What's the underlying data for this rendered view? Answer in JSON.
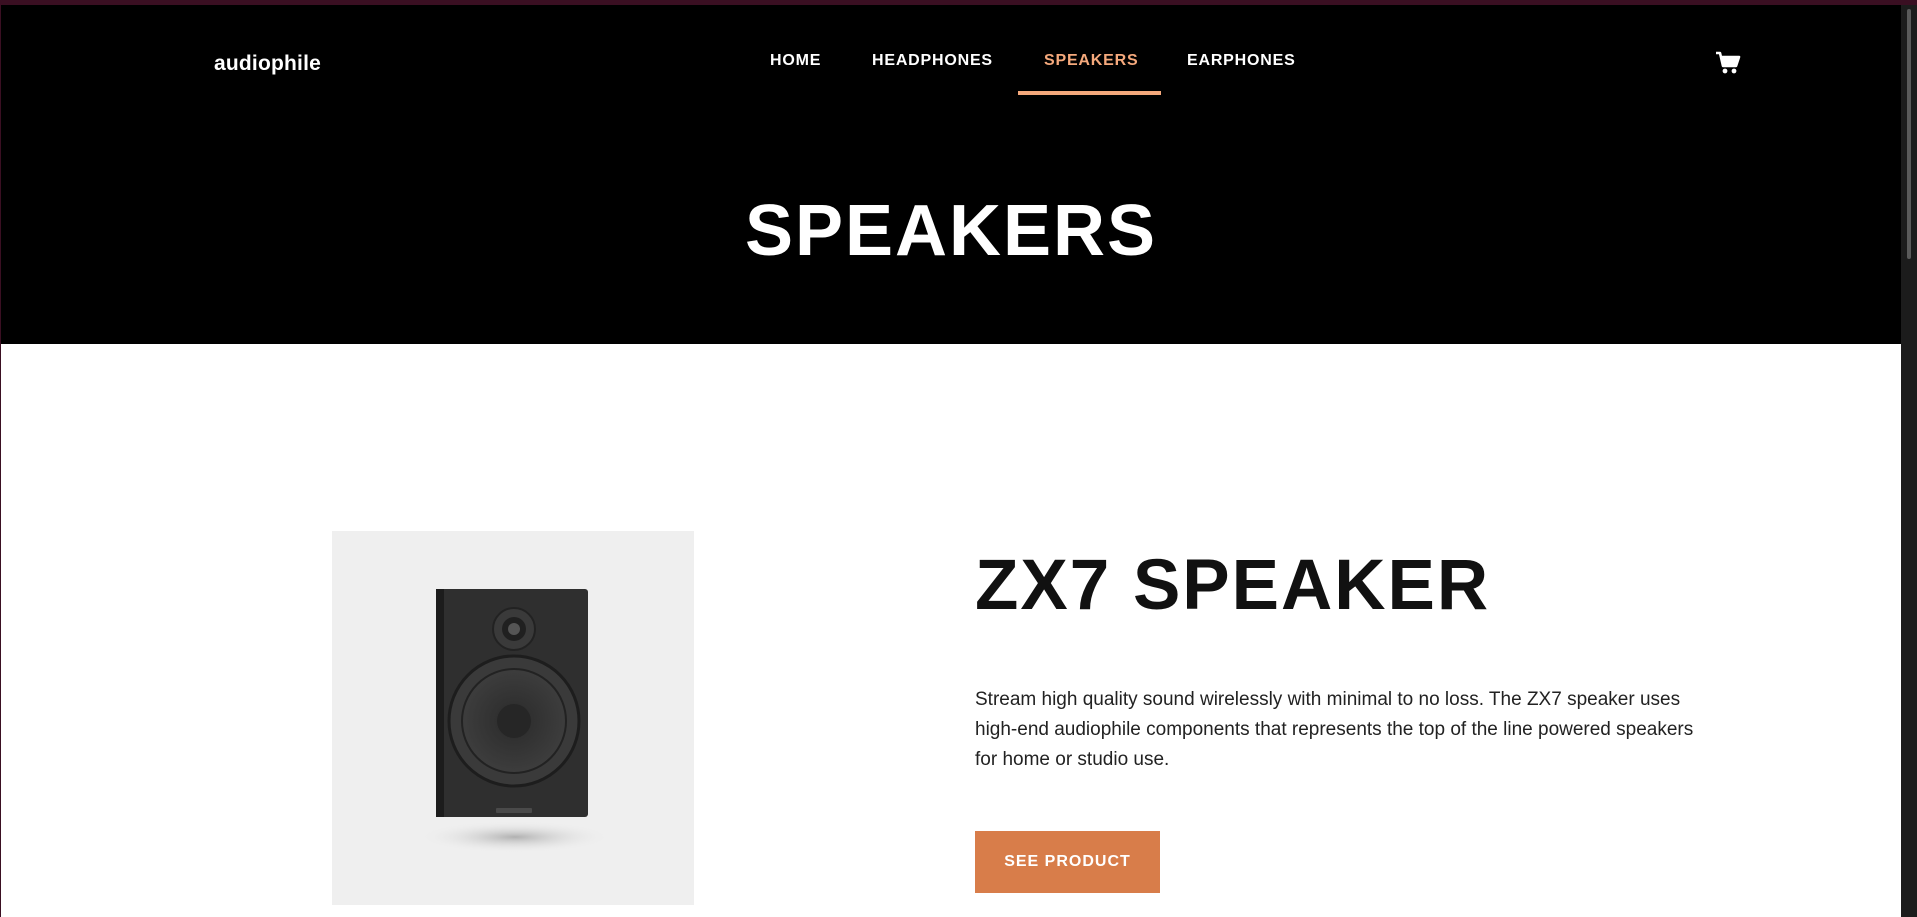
{
  "header": {
    "logo": "audiophile",
    "nav": [
      {
        "label": "HOME",
        "active": false
      },
      {
        "label": "HEADPHONES",
        "active": false
      },
      {
        "label": "SPEAKERS",
        "active": true
      },
      {
        "label": "EARPHONES",
        "active": false
      }
    ],
    "cart_icon": "shopping-cart-icon"
  },
  "hero": {
    "title": "SPEAKERS"
  },
  "product": {
    "title": "ZX7 SPEAKER",
    "description": "Stream high quality sound wirelessly with minimal to no loss. The ZX7 speaker uses high-end audiophile components that represents the top of the line powered speakers for home or studio use.",
    "cta_label": "SEE PRODUCT"
  },
  "colors": {
    "accent": "#d87d4a",
    "accent_light": "#f5a97c",
    "hero_background": "#000000",
    "image_background": "#efefef"
  }
}
